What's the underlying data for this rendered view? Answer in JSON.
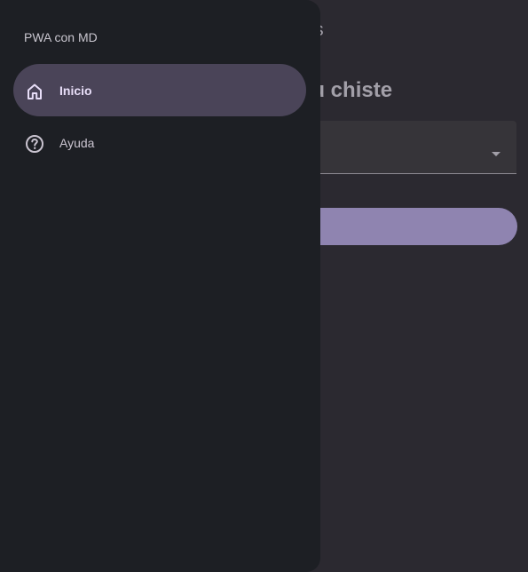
{
  "background": {
    "header_text": "sas",
    "heading": "r su chiste"
  },
  "drawer": {
    "title": "PWA con MD",
    "items": [
      {
        "label": "Inicio",
        "icon": "home-icon",
        "active": true
      },
      {
        "label": "Ayuda",
        "icon": "help-circle-icon",
        "active": false
      }
    ]
  },
  "colors": {
    "drawer_bg": "#1d1f24",
    "active_item_bg": "#4a4458",
    "active_item_text": "#e8def8",
    "button_bg": "#8f84b0"
  }
}
